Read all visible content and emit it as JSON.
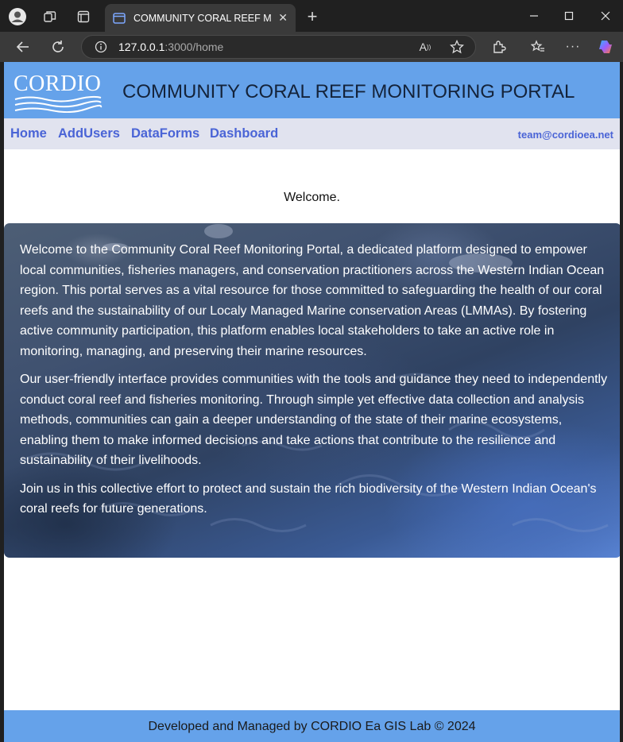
{
  "browser": {
    "tab_title": "COMMUNITY CORAL REEF MONIT",
    "url_host": "127.0.0.1",
    "url_path": ":3000/home"
  },
  "header": {
    "logo_text": "CORDIO",
    "title": "COMMUNITY CORAL REEF MONITORING PORTAL"
  },
  "nav": {
    "items": [
      {
        "label": "Home"
      },
      {
        "label": "AddUsers"
      },
      {
        "label": "DataForms"
      },
      {
        "label": "Dashboard"
      }
    ],
    "email": "team@cordioea.net"
  },
  "main": {
    "welcome": "Welcome.",
    "paragraphs": [
      "Welcome to the Community Coral Reef Monitoring Portal, a dedicated platform designed to empower local communities, fisheries managers, and conservation practitioners across the Western Indian Ocean region. This portal serves as a vital resource for those committed to safeguarding the health of our coral reefs and the sustainability of our Localy Managed Marine conservation Areas (LMMAs). By fostering active community participation, this platform enables local stakeholders to take an active role in monitoring, managing, and preserving their marine resources.",
      "Our user-friendly interface provides communities with the tools and guidance they need to independently conduct coral reef and fisheries monitoring. Through simple yet effective data collection and analysis methods, communities can gain a deeper understanding of the state of their marine ecosystems, enabling them to make informed decisions and take actions that contribute to the resilience and sustainability of their livelihoods.",
      "Join us in this collective effort to protect and sustain the rich biodiversity of the Western Indian Ocean's coral reefs for future generations."
    ]
  },
  "footer": {
    "text": "Developed and Managed by CORDIO Ea GIS Lab © 2024"
  },
  "colors": {
    "header_bg": "#65a2ea",
    "nav_bg": "#e1e3ef",
    "nav_link": "#4a64d6"
  }
}
